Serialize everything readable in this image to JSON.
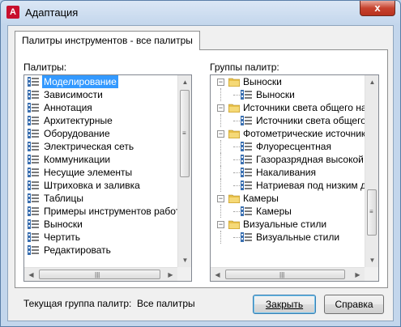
{
  "window": {
    "title": "Адаптация",
    "app_icon_letter": "A",
    "close_glyph": "x"
  },
  "tab": {
    "label": "Палитры инструментов - все палитры"
  },
  "palettes": {
    "label": "Палитры:",
    "items": [
      "Моделирование",
      "Зависимости",
      "Аннотация",
      "Архитектурные",
      "Оборудование",
      "Электрическая сеть",
      "Коммуникации",
      "Несущие элементы",
      "Штриховка и заливка",
      "Таблицы",
      "Примеры инструментов работы с",
      "Выноски",
      "Чертить",
      "Редактировать"
    ],
    "selected_index": 0
  },
  "groups": {
    "label": "Группы палитр:",
    "tree": [
      {
        "level": 0,
        "text": "Выноски",
        "type": "group"
      },
      {
        "level": 1,
        "text": "Выноски",
        "type": "palette"
      },
      {
        "level": 0,
        "text": "Источники света общего назн",
        "type": "group"
      },
      {
        "level": 1,
        "text": "Источники света общего н",
        "type": "palette"
      },
      {
        "level": 0,
        "text": "Фотометрические источники",
        "type": "group"
      },
      {
        "level": 1,
        "text": "Флуоресцентная",
        "type": "palette"
      },
      {
        "level": 1,
        "text": "Газоразрядная высокой и",
        "type": "palette"
      },
      {
        "level": 1,
        "text": "Накаливания",
        "type": "palette"
      },
      {
        "level": 1,
        "text": "Натриевая под низким да",
        "type": "palette"
      },
      {
        "level": 0,
        "text": "Камеры",
        "type": "group"
      },
      {
        "level": 1,
        "text": "Камеры",
        "type": "palette"
      },
      {
        "level": 0,
        "text": "Визуальные стили",
        "type": "group"
      },
      {
        "level": 1,
        "text": "Визуальные стили",
        "type": "palette"
      }
    ]
  },
  "current_group": {
    "label": "Текущая группа палитр:",
    "value": "Все палитры"
  },
  "buttons": {
    "close_label": "Закрыть",
    "help_label": "Справка"
  },
  "colors": {
    "selection": "#3399ff",
    "folder": "#e8c04a",
    "palette_icon": "#3a6fb0"
  }
}
